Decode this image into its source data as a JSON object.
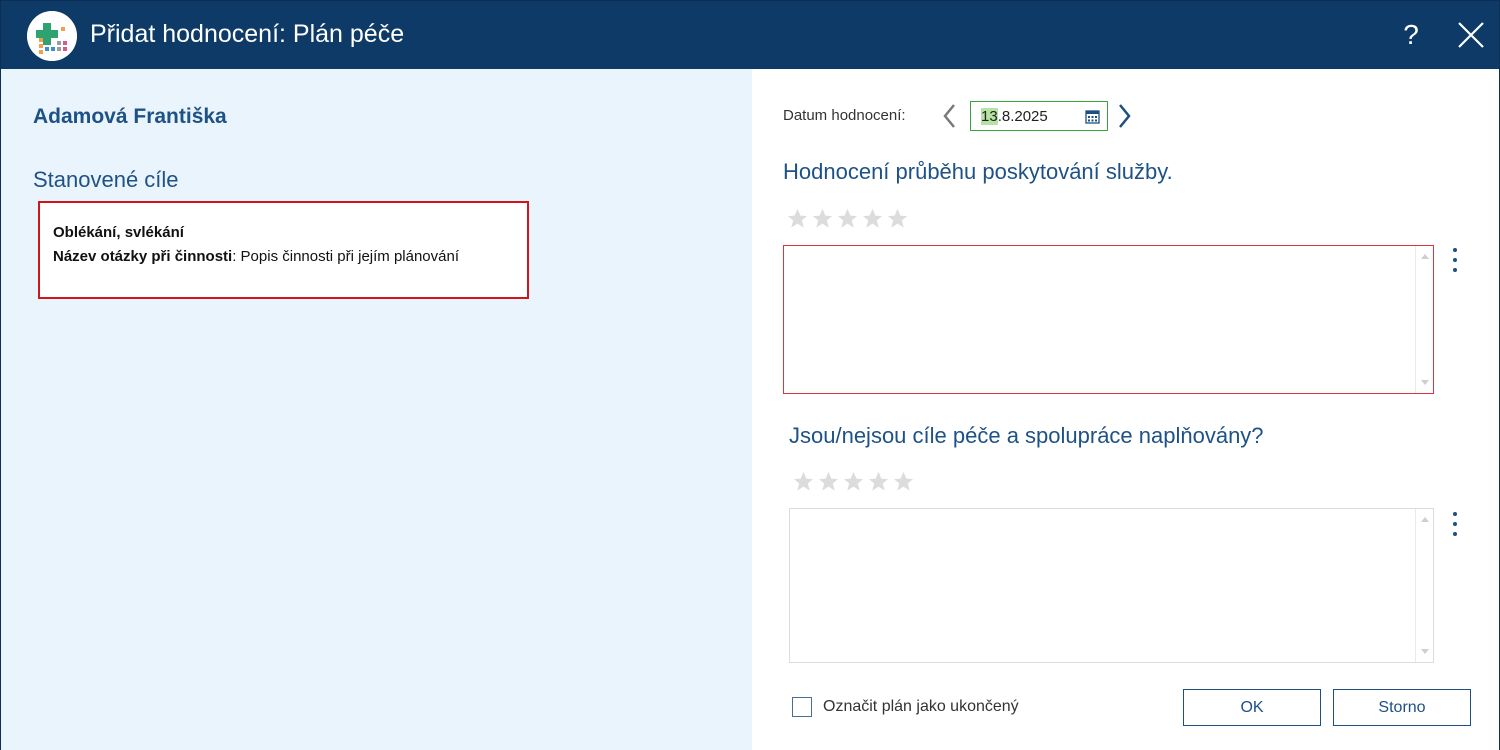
{
  "window": {
    "title": "Přidat hodnocení: Plán péče",
    "help_label": "?",
    "title_bar_color": "#0d3a66",
    "icons": [
      "app-logo-icon",
      "help-icon",
      "close-icon"
    ]
  },
  "left": {
    "client_name": "Adamová Františka",
    "goals_heading": "Stanovené cíle",
    "goal": {
      "title": "Oblékání, svlékání",
      "question_label": "Název otázky při činnosti",
      "question_text": ": Popis činnosti při jejím plánování"
    },
    "selection_border_color": "#d3141b"
  },
  "right": {
    "date_label": "Datum hodnocení:",
    "date": {
      "selected_part": "13",
      "rest": ".8.2025"
    },
    "questions": [
      {
        "heading": "Hodnocení průběhu poskytování služby.",
        "rating": 0,
        "max_rating": 5,
        "text": ""
      },
      {
        "heading": "Jsou/nejsou cíle péče a spolupráce naplňovány?",
        "rating": 0,
        "max_rating": 5,
        "text": ""
      }
    ],
    "mark_finished_label": "Označit plán jako ukončený",
    "mark_finished_checked": false,
    "ok_label": "OK",
    "cancel_label": "Storno",
    "accent_color": "#1e5286"
  }
}
